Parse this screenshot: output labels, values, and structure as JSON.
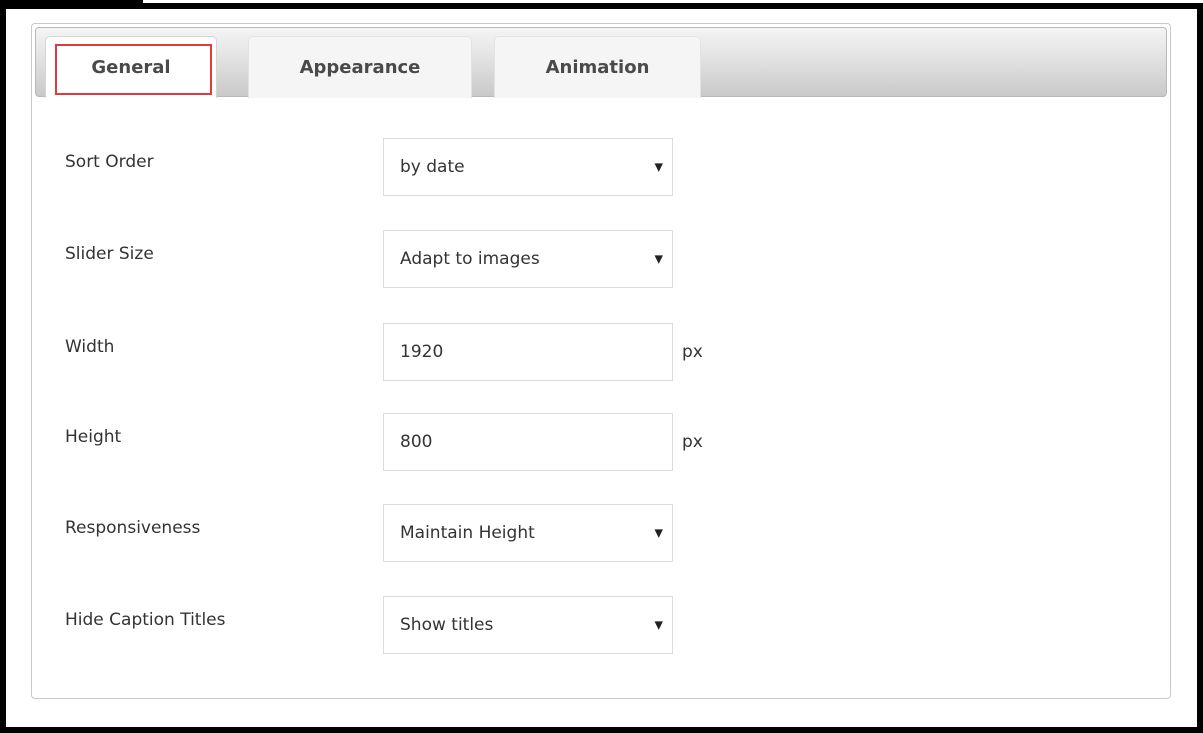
{
  "tabs": [
    {
      "label": "General",
      "active": true,
      "highlighted": true
    },
    {
      "label": "Appearance",
      "active": false
    },
    {
      "label": "Animation",
      "active": false
    }
  ],
  "settings": {
    "sort_order": {
      "label": "Sort Order",
      "value": "by date"
    },
    "slider_size": {
      "label": "Slider Size",
      "value": "Adapt to images"
    },
    "width": {
      "label": "Width",
      "value": "1920",
      "unit": "px"
    },
    "height": {
      "label": "Height",
      "value": "800",
      "unit": "px"
    },
    "responsiveness": {
      "label": "Responsiveness",
      "value": "Maintain Height"
    },
    "hide_caption_titles": {
      "label": "Hide Caption Titles",
      "value": "Show titles"
    }
  },
  "icons": {
    "dropdown_caret": "caret-down-icon"
  },
  "colors": {
    "highlight_border": "#e0393e",
    "frame_border": "#000000"
  }
}
